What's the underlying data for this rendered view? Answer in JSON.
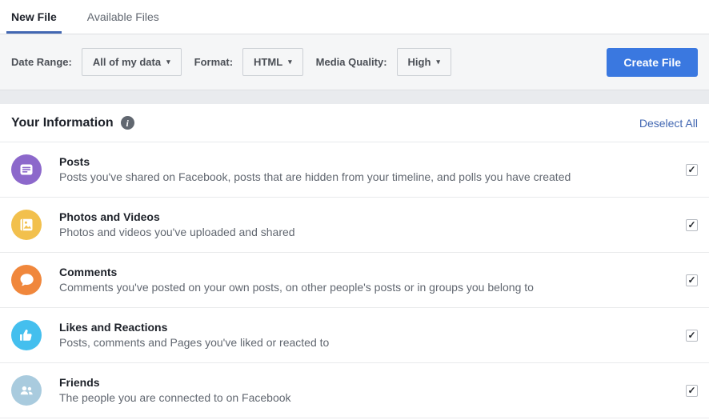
{
  "tabs": {
    "new_file": "New File",
    "available_files": "Available Files"
  },
  "toolbar": {
    "date_range_label": "Date Range:",
    "date_range_value": "All of my data",
    "format_label": "Format:",
    "format_value": "HTML",
    "media_quality_label": "Media Quality:",
    "media_quality_value": "High",
    "create_file_label": "Create File"
  },
  "section": {
    "title": "Your Information",
    "deselect_all_label": "Deselect All"
  },
  "items": [
    {
      "title": "Posts",
      "description": "Posts you've shared on Facebook, posts that are hidden from your timeline, and polls you have created",
      "icon": "posts-icon",
      "icon_color": "#8c68cb",
      "checked": true
    },
    {
      "title": "Photos and Videos",
      "description": "Photos and videos you've uploaded and shared",
      "icon": "photos-icon",
      "icon_color": "#f2c04d",
      "checked": true
    },
    {
      "title": "Comments",
      "description": "Comments you've posted on your own posts, on other people's posts or in groups you belong to",
      "icon": "comments-icon",
      "icon_color": "#f0873c",
      "checked": true
    },
    {
      "title": "Likes and Reactions",
      "description": "Posts, comments and Pages you've liked or reacted to",
      "icon": "likes-icon",
      "icon_color": "#44bfee",
      "checked": true
    },
    {
      "title": "Friends",
      "description": "The people you are connected to on Facebook",
      "icon": "friends-icon",
      "icon_color": "#a9cbde",
      "checked": true
    }
  ],
  "glyphs": {
    "caret_down": "▾",
    "check": "✓",
    "info": "i"
  },
  "colors": {
    "accent_button_blue": "#3a78e0",
    "tab_underline_blue": "#4267b2",
    "link_blue": "#4267b2",
    "toolbar_bg": "#f5f6f7",
    "gap_bg": "#e9ebee",
    "border": "#dddfe2",
    "primary_text": "#1d2129",
    "secondary_text": "#616770",
    "info_icon_bg": "#616770"
  }
}
